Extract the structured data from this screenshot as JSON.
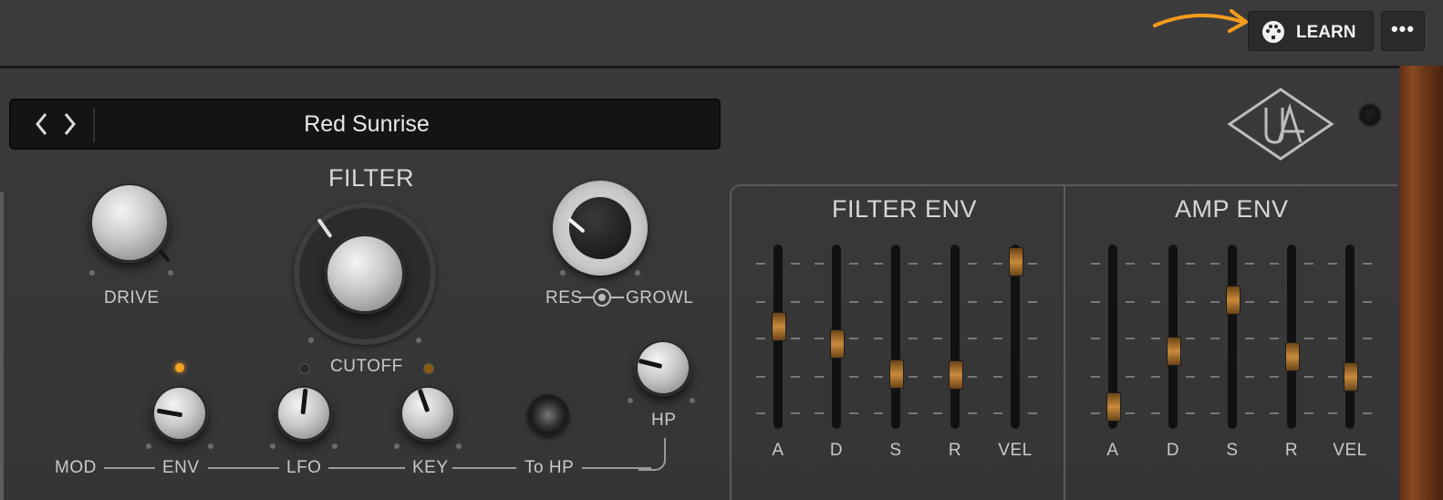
{
  "toolbar": {
    "learn_label": "LEARN",
    "more_label": "•••",
    "accent_arrow_color": "#f39a1c"
  },
  "preset": {
    "name": "Red Sunrise",
    "prev_icon": "chevron-left-icon",
    "next_icon": "chevron-right-icon"
  },
  "filter": {
    "title": "FILTER",
    "drive_label": "DRIVE",
    "cutoff_label": "CUTOFF",
    "res_label": "RES",
    "growl_label": "GROWL",
    "hp_label": "HP"
  },
  "mod": {
    "mod_label": "MOD",
    "env_label": "ENV",
    "lfo_label": "LFO",
    "key_label": "KEY",
    "tohp_label": "To HP"
  },
  "filter_env": {
    "title": "FILTER ENV",
    "sliders": [
      {
        "label": "A",
        "level": 0.57
      },
      {
        "label": "D",
        "level": 0.46
      },
      {
        "label": "S",
        "level": 0.27
      },
      {
        "label": "R",
        "level": 0.26
      },
      {
        "label": "VEL",
        "level": 0.98
      }
    ]
  },
  "amp_env": {
    "title": "AMP ENV",
    "sliders": [
      {
        "label": "A",
        "level": 0.06
      },
      {
        "label": "D",
        "level": 0.41
      },
      {
        "label": "S",
        "level": 0.74
      },
      {
        "label": "R",
        "level": 0.38
      },
      {
        "label": "VEL",
        "level": 0.25
      }
    ]
  },
  "colors": {
    "slider_thumb": "#c98b3c",
    "led_on": "#f5a321",
    "led_off": "#3a3a3a"
  }
}
